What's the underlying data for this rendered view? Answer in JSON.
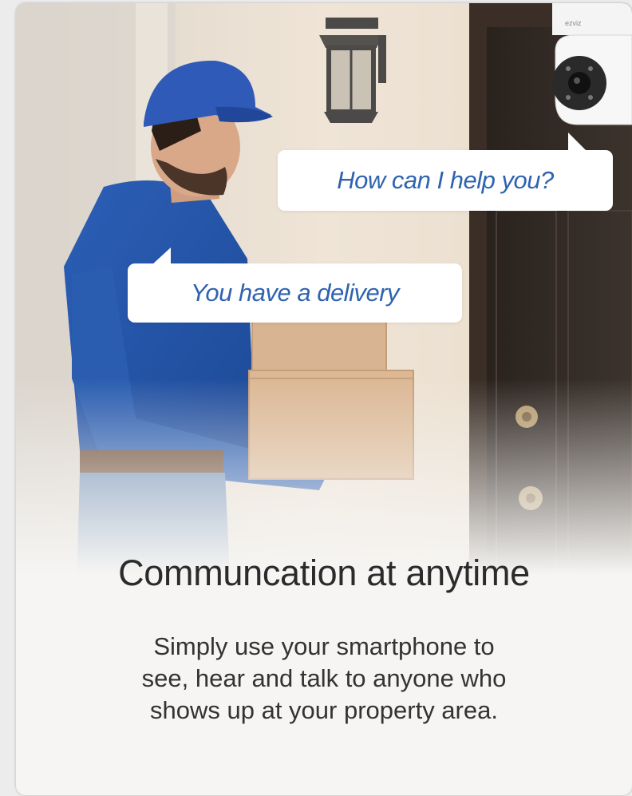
{
  "bubbles": {
    "camera_speech": "How can I help you?",
    "visitor_speech": "You have a delivery"
  },
  "camera": {
    "brand": "ezviz"
  },
  "content": {
    "title": "Communcation at anytime",
    "description_lines": [
      "Simply use your smartphone to",
      "see, hear and talk to anyone who",
      "shows up at your property area."
    ]
  },
  "colors": {
    "bubble_text": "#2f63b0",
    "title_text": "#2b2b2b",
    "body_text": "#333333",
    "card_background": "#f6f5f3"
  },
  "icons": [
    "outdoor-wall-lamp-icon",
    "security-camera-icon",
    "door-knob-icon"
  ]
}
